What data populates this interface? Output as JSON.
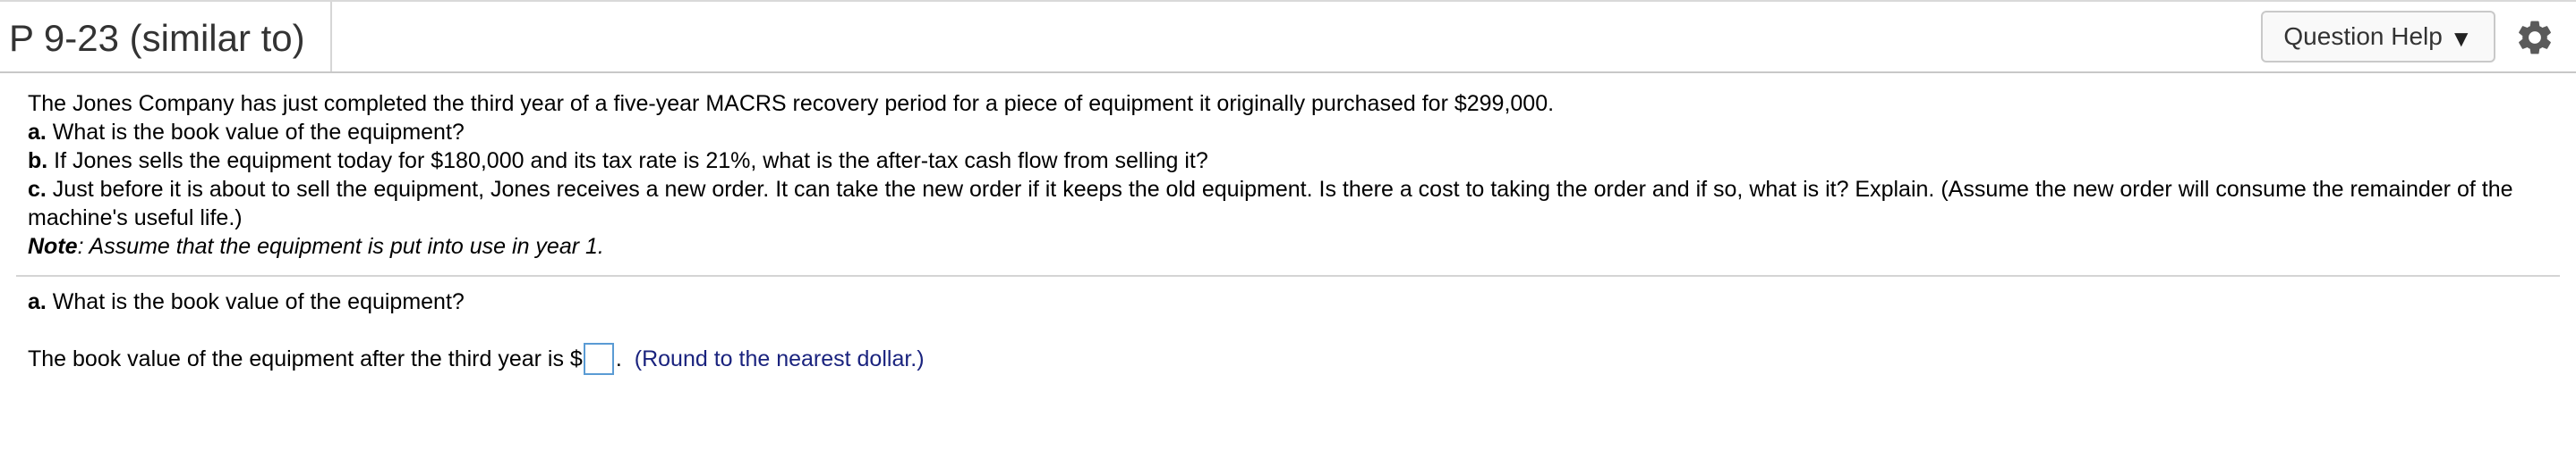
{
  "header": {
    "title": "P 9-23 (similar to)",
    "question_help_label": "Question Help",
    "question_help_caret": "▼",
    "settings_icon": "gear-icon"
  },
  "problem": {
    "intro": "The Jones Company has just completed the third year of a five-year MACRS recovery period for a piece of equipment it originally purchased for $299,000.",
    "part_a_label": "a.",
    "part_a_text": " What is the book value of the equipment?",
    "part_b_label": "b.",
    "part_b_text": " If Jones sells the equipment today for $180,000 and its tax rate is 21%, what is the after-tax cash flow from selling it?",
    "part_c_label": "c.",
    "part_c_text": " Just before it is about to sell the equipment, Jones receives a new order. It can take the new order if it keeps the old equipment. Is there a cost to taking the order and if so, what is it? Explain. (Assume the new order will consume the remainder of the machine's useful life.)",
    "note_label": "Note",
    "note_text": ": Assume that the equipment is put into use in year 1."
  },
  "answer_section": {
    "question_label": "a.",
    "question_text": " What is the book value of the equipment?",
    "sentence_prefix": "The book value of the equipment after the third year is $",
    "input_value": "",
    "sentence_suffix": ".",
    "hint": "(Round to the nearest dollar.)"
  },
  "colors": {
    "hint_text": "#1a237e",
    "input_border": "#5a9bd4",
    "gear": "#5a5a5a"
  }
}
